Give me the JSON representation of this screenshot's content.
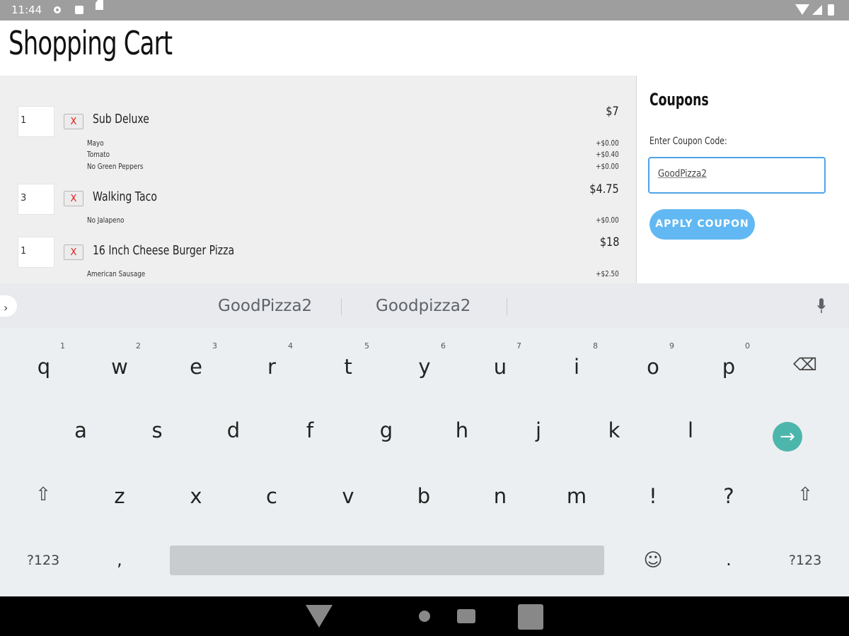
{
  "status_bar": {
    "time": "11:44"
  },
  "header": {
    "title": "Shopping Cart"
  },
  "cart": {
    "items": [
      {
        "qty": "1",
        "remove": "X",
        "name": "Sub Deluxe",
        "price": "$7",
        "options": [
          {
            "name": "Mayo",
            "price": "+$0.00"
          },
          {
            "name": "Tomato",
            "price": "+$0.40"
          },
          {
            "name": "No Green Peppers",
            "price": "+$0.00"
          }
        ]
      },
      {
        "qty": "3",
        "remove": "X",
        "name": "Walking Taco",
        "price": "$4.75",
        "options": [
          {
            "name": "No Jalapeno",
            "price": "+$0.00"
          }
        ]
      },
      {
        "qty": "1",
        "remove": "X",
        "name": "16 Inch Cheese Burger Pizza",
        "price": "$18",
        "options": [
          {
            "name": "American Sausage",
            "price": "+$2.50"
          }
        ]
      }
    ]
  },
  "coupons": {
    "heading": "Coupons",
    "label": "Enter Coupon Code:",
    "input_value": "GoodPizza2",
    "apply_label": "APPLY COUPON"
  },
  "keyboard": {
    "suggestions": [
      "GoodPizza2",
      "Goodpizza2"
    ],
    "row1": [
      {
        "k": "q",
        "h": "1"
      },
      {
        "k": "w",
        "h": "2"
      },
      {
        "k": "e",
        "h": "3"
      },
      {
        "k": "r",
        "h": "4"
      },
      {
        "k": "t",
        "h": "5"
      },
      {
        "k": "y",
        "h": "6"
      },
      {
        "k": "u",
        "h": "7"
      },
      {
        "k": "i",
        "h": "8"
      },
      {
        "k": "o",
        "h": "9"
      },
      {
        "k": "p",
        "h": "0"
      }
    ],
    "row2": [
      "a",
      "s",
      "d",
      "f",
      "g",
      "h",
      "j",
      "k",
      "l"
    ],
    "row3": [
      "z",
      "x",
      "c",
      "v",
      "b",
      "n",
      "m",
      "!",
      "?"
    ],
    "symbols_label": "?123",
    "comma": ",",
    "period": ".",
    "shift_glyph": "⇧",
    "backspace_glyph": "⌫",
    "enter_glyph": "→",
    "emoji_glyph": "☺"
  },
  "colors": {
    "accent": "#62b8f2",
    "remove_x": "#e21a1a",
    "enter": "#4db6ac"
  }
}
